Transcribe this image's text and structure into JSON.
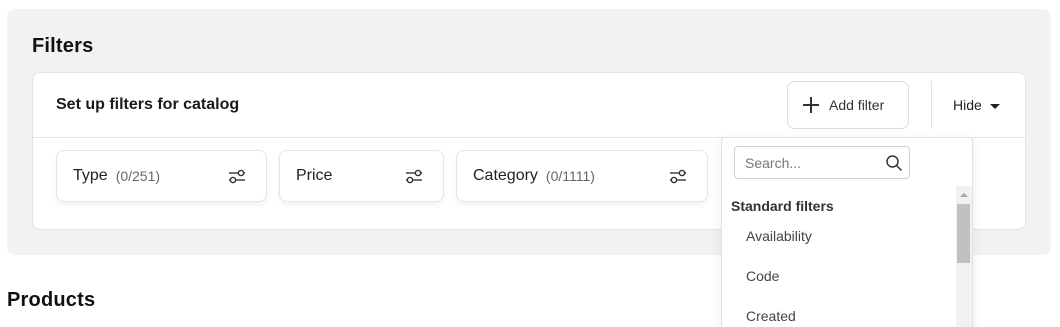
{
  "filters": {
    "title": "Filters",
    "card": {
      "title": "Set up filters for catalog",
      "add_filter_label": "Add filter",
      "hide_label": "Hide"
    },
    "chips": [
      {
        "label": "Type",
        "count": "(0/251)"
      },
      {
        "label": "Price",
        "count": ""
      },
      {
        "label": "Category",
        "count": "(0/1111)"
      }
    ]
  },
  "dropdown": {
    "search_placeholder": "Search...",
    "group_label": "Standard filters",
    "options": [
      "Availability",
      "Code",
      "Created"
    ]
  },
  "products": {
    "title": "Products"
  },
  "icons": {
    "add": "plus-icon",
    "hide": "caret-down-icon",
    "chip": "sliders-icon",
    "search": "search-icon"
  }
}
